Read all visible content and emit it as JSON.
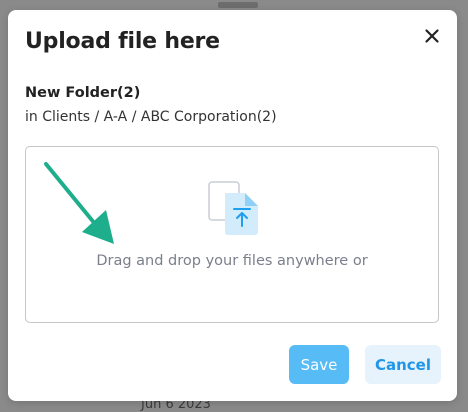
{
  "backdrop": {
    "bottom_date": "Jun 6 2023"
  },
  "modal": {
    "title": "Upload file here",
    "folder_name": "New Folder(2)",
    "folder_path": "in Clients / A-A / ABC Corporation(2)",
    "dropzone_text": "Drag and drop your files anywhere or",
    "save_label": "Save",
    "cancel_label": "Cancel",
    "close_icon": "close-icon",
    "upload_icon": "file-upload-icon"
  },
  "colors": {
    "primary": "#3ab0f5",
    "cancel_bg": "#e6f3fc",
    "cancel_text": "#2196e8",
    "annotation_arrow": "#1fae8c"
  }
}
